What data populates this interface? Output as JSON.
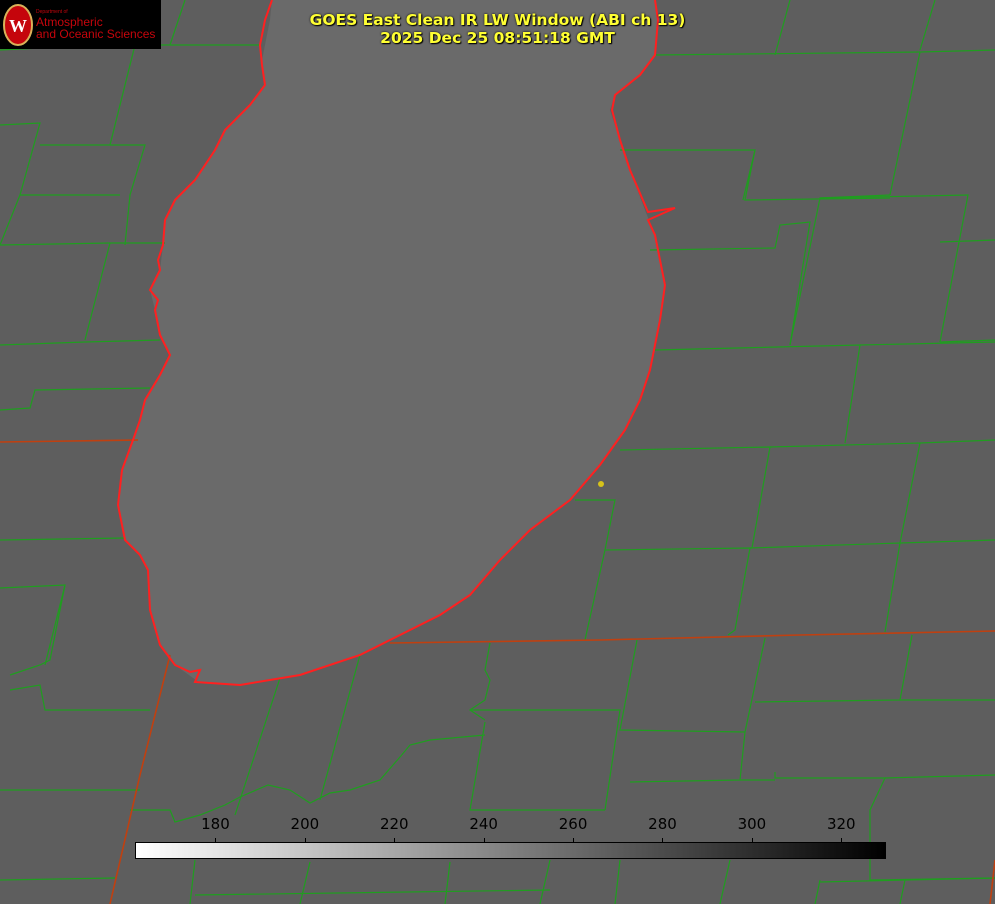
{
  "title": {
    "line1": "GOES East Clean IR LW Window (ABI ch 13)",
    "line2": "2025 Dec 25 08:51:18 GMT",
    "color": "#ffff33"
  },
  "logo": {
    "dept": "Department of",
    "line1": "Atmospheric",
    "line2": "and Oceanic Sciences",
    "color": "#c5050c",
    "icon": "uw-crest-icon"
  },
  "colorbar": {
    "min": 162,
    "max": 330,
    "start_color": "#ffffff",
    "end_color": "#000000",
    "ticks": [
      "180",
      "200",
      "220",
      "240",
      "260",
      "280",
      "300",
      "320"
    ]
  },
  "map_colors": {
    "background": "#5e5e5e",
    "lake": "#6a6a6a",
    "county_lines": "#1f9e1f",
    "coastline": "#ff2020",
    "state_lines": "#c04010",
    "marker": "#d6c21a"
  }
}
